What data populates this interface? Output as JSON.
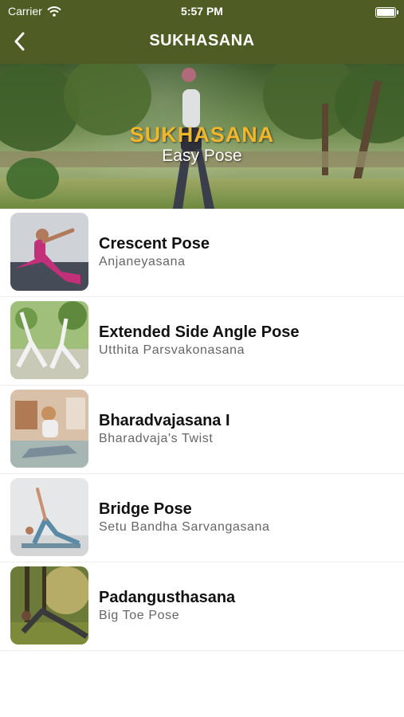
{
  "status_bar": {
    "carrier": "Carrier",
    "time": "5:57 PM"
  },
  "nav": {
    "title": "SUKHASANA"
  },
  "hero": {
    "title": "SUKHASANA",
    "subtitle": "Easy Pose",
    "title_color": "#f0b62c"
  },
  "colors": {
    "header_bg": "#4f5c24"
  },
  "poses": [
    {
      "name": "Crescent Pose",
      "sanskrit": "Anjaneyasana"
    },
    {
      "name": "Extended Side Angle Pose",
      "sanskrit": "Utthita Parsvakonasana"
    },
    {
      "name": "Bharadvajasana I",
      "sanskrit": "Bharadvaja's Twist"
    },
    {
      "name": "Bridge Pose",
      "sanskrit": "Setu Bandha Sarvangasana"
    },
    {
      "name": "Padangusthasana",
      "sanskrit": "Big Toe Pose"
    }
  ]
}
